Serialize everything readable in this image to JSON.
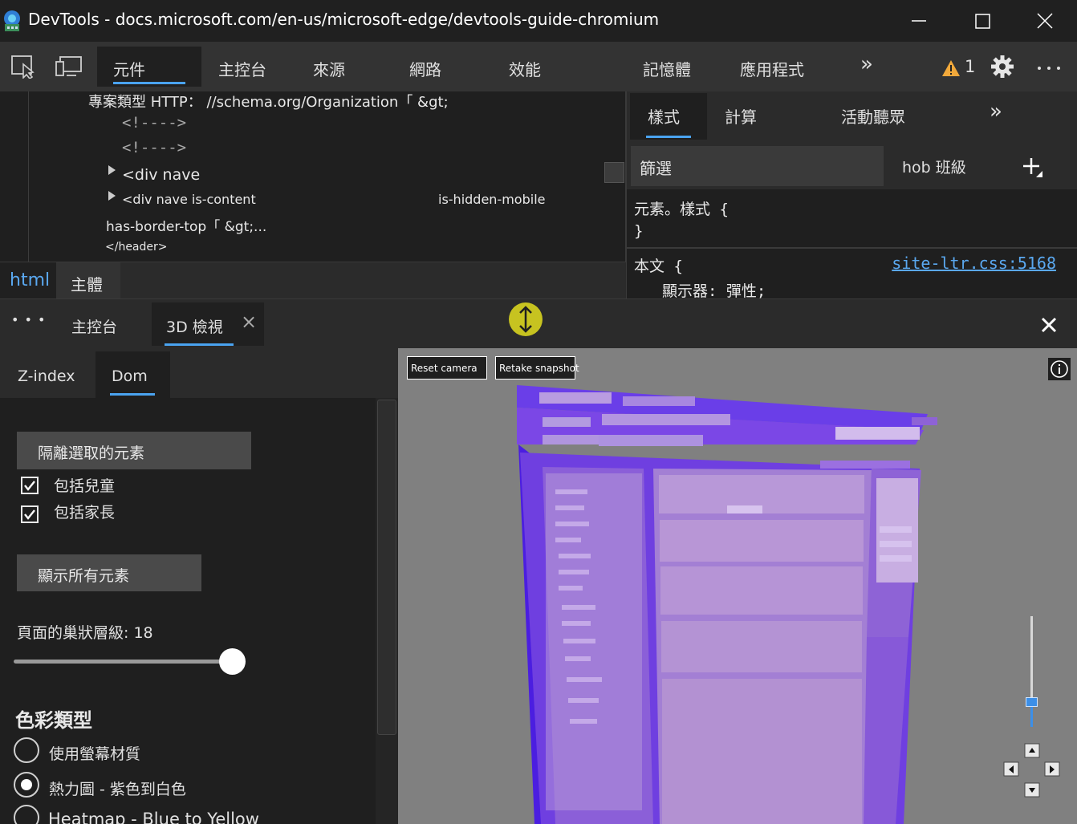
{
  "window": {
    "title": "DevTools - docs.microsoft.com/en-us/microsoft-edge/devtools-guide-chromium"
  },
  "main_tabs": [
    "元件",
    "主控台",
    "來源",
    "網路",
    "效能",
    "記憶體",
    "應用程式"
  ],
  "toolbar": {
    "more_tabs": "»",
    "warning_count": "1"
  },
  "elements": {
    "lines": [
      "專案類型 HTTP： //schema.org/Organization「 &gt;",
      "<!---->",
      "<!---->",
      "<div nave",
      "<div nave is-content",
      "is-hidden-mobile",
      "has-border-top「 &gt;...",
      "</header>"
    ],
    "breadcrumbs": [
      "html",
      "主體"
    ]
  },
  "styles": {
    "tabs": [
      "樣式",
      "計算",
      "活動聽眾"
    ],
    "more": "»",
    "filter_placeholder": "篩選",
    "hov_cls": "hob 班級",
    "element_style": "元素。樣式 {",
    "close_brace": "}",
    "body_rule": "本文 {",
    "body_source": "site-ltr.css:5168",
    "body_decl": "顯示器: 彈性;"
  },
  "drawer": {
    "more": "• • •",
    "tabs": [
      "主控台",
      "3D 檢視"
    ],
    "close_tab": "×"
  },
  "panel3d": {
    "tabs": [
      "Z-index",
      "Dom"
    ],
    "isolate_button": "隔離選取的元素",
    "include_children": "包括兒童",
    "include_parents": "包括家長",
    "show_all_button": "顯示所有元素",
    "nesting_label": "頁面的巢狀層級: 18",
    "nesting_value": 18,
    "nesting_max": 18,
    "color_type_heading": "色彩類型",
    "color_options": [
      "使用螢幕材質",
      "熱力圖 - 紫色到白色",
      "Heatmap - Blue to Yellow"
    ],
    "selected_color_option": 1
  },
  "viewport": {
    "reset_camera": "Reset camera",
    "retake_snapshot": "Retake snapshot",
    "zoom_level": 0.2
  },
  "colors": {
    "accent": "#4aa3f0",
    "handle": "#c7c320",
    "viewport_bg": "#808080",
    "layer_dark": "#5a1ee6",
    "layer_light": "#c3a4e6"
  }
}
